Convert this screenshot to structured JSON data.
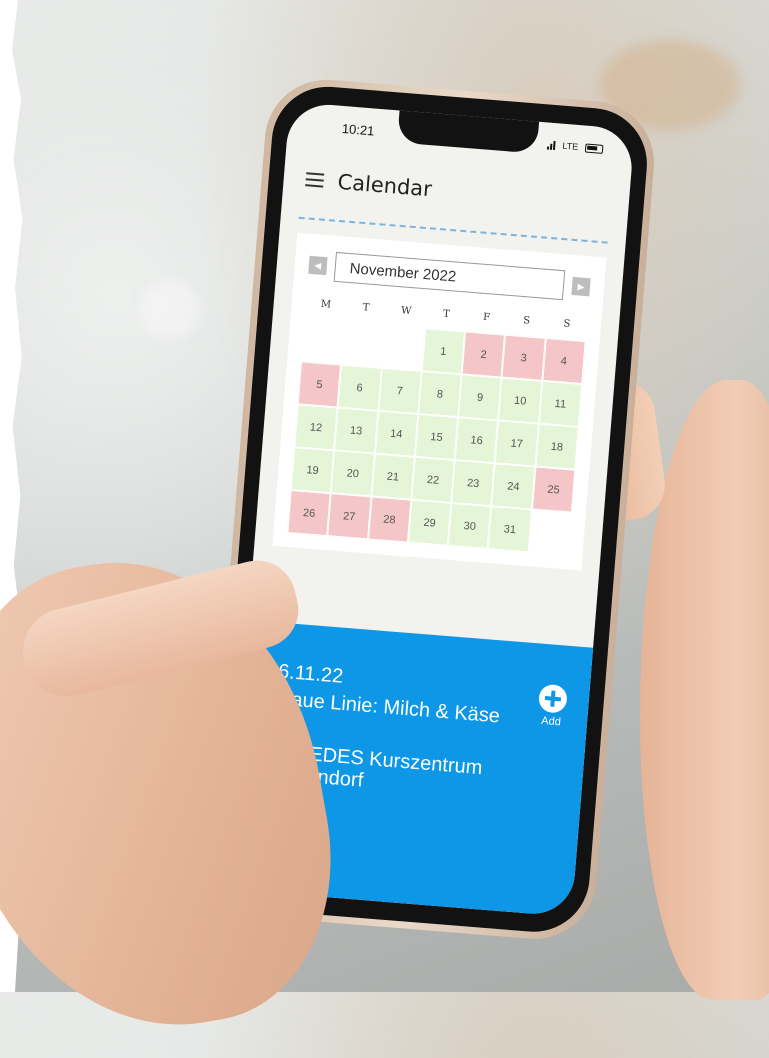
{
  "status_bar": {
    "time": "10:21",
    "network": "LTE"
  },
  "header": {
    "title": "Calendar"
  },
  "calendar": {
    "month_label": "November 2022",
    "prev_icon": "triangle-left-icon",
    "next_icon": "triangle-right-icon",
    "weekdays": [
      "M",
      "T",
      "W",
      "T",
      "F",
      "S",
      "S"
    ],
    "weeks": [
      [
        {
          "d": ""
        },
        {
          "d": ""
        },
        {
          "d": ""
        },
        {
          "d": "1",
          "s": "green"
        },
        {
          "d": "2",
          "s": "red"
        },
        {
          "d": "3",
          "s": "red"
        },
        {
          "d": "4",
          "s": "red"
        }
      ],
      [
        {
          "d": "5",
          "s": "red"
        },
        {
          "d": "6",
          "s": "green"
        },
        {
          "d": "7",
          "s": "green"
        },
        {
          "d": "8",
          "s": "green"
        },
        {
          "d": "9",
          "s": "green"
        },
        {
          "d": "10",
          "s": "green"
        },
        {
          "d": "11",
          "s": "green"
        }
      ],
      [
        {
          "d": "12",
          "s": "green"
        },
        {
          "d": "13",
          "s": "green"
        },
        {
          "d": "14",
          "s": "green"
        },
        {
          "d": "15",
          "s": "green"
        },
        {
          "d": "16",
          "s": "green"
        },
        {
          "d": "17",
          "s": "green"
        },
        {
          "d": "18",
          "s": "green"
        }
      ],
      [
        {
          "d": "19",
          "s": "green"
        },
        {
          "d": "20",
          "s": "green"
        },
        {
          "d": "21",
          "s": "green"
        },
        {
          "d": "22",
          "s": "green"
        },
        {
          "d": "23",
          "s": "green"
        },
        {
          "d": "24",
          "s": "green"
        },
        {
          "d": "25",
          "s": "red"
        }
      ],
      [
        {
          "d": "26",
          "s": "red"
        },
        {
          "d": "27",
          "s": "red"
        },
        {
          "d": "28",
          "s": "red"
        },
        {
          "d": "29",
          "s": "green"
        },
        {
          "d": "30",
          "s": "green"
        },
        {
          "d": "31",
          "s": "green"
        },
        {
          "d": ""
        }
      ]
    ],
    "colors": {
      "available": "#e4f6d7",
      "unavailable": "#f4c6c7"
    }
  },
  "event": {
    "date": "6.11.22",
    "title": "blaue Linie: Milch & Käse",
    "location_line1": "VELEDES Kurszentrum",
    "location_line2": "Dübendorf",
    "add_label": "Add",
    "add_icon": "plus-circle-icon",
    "accent_color": "#0e97e6"
  }
}
